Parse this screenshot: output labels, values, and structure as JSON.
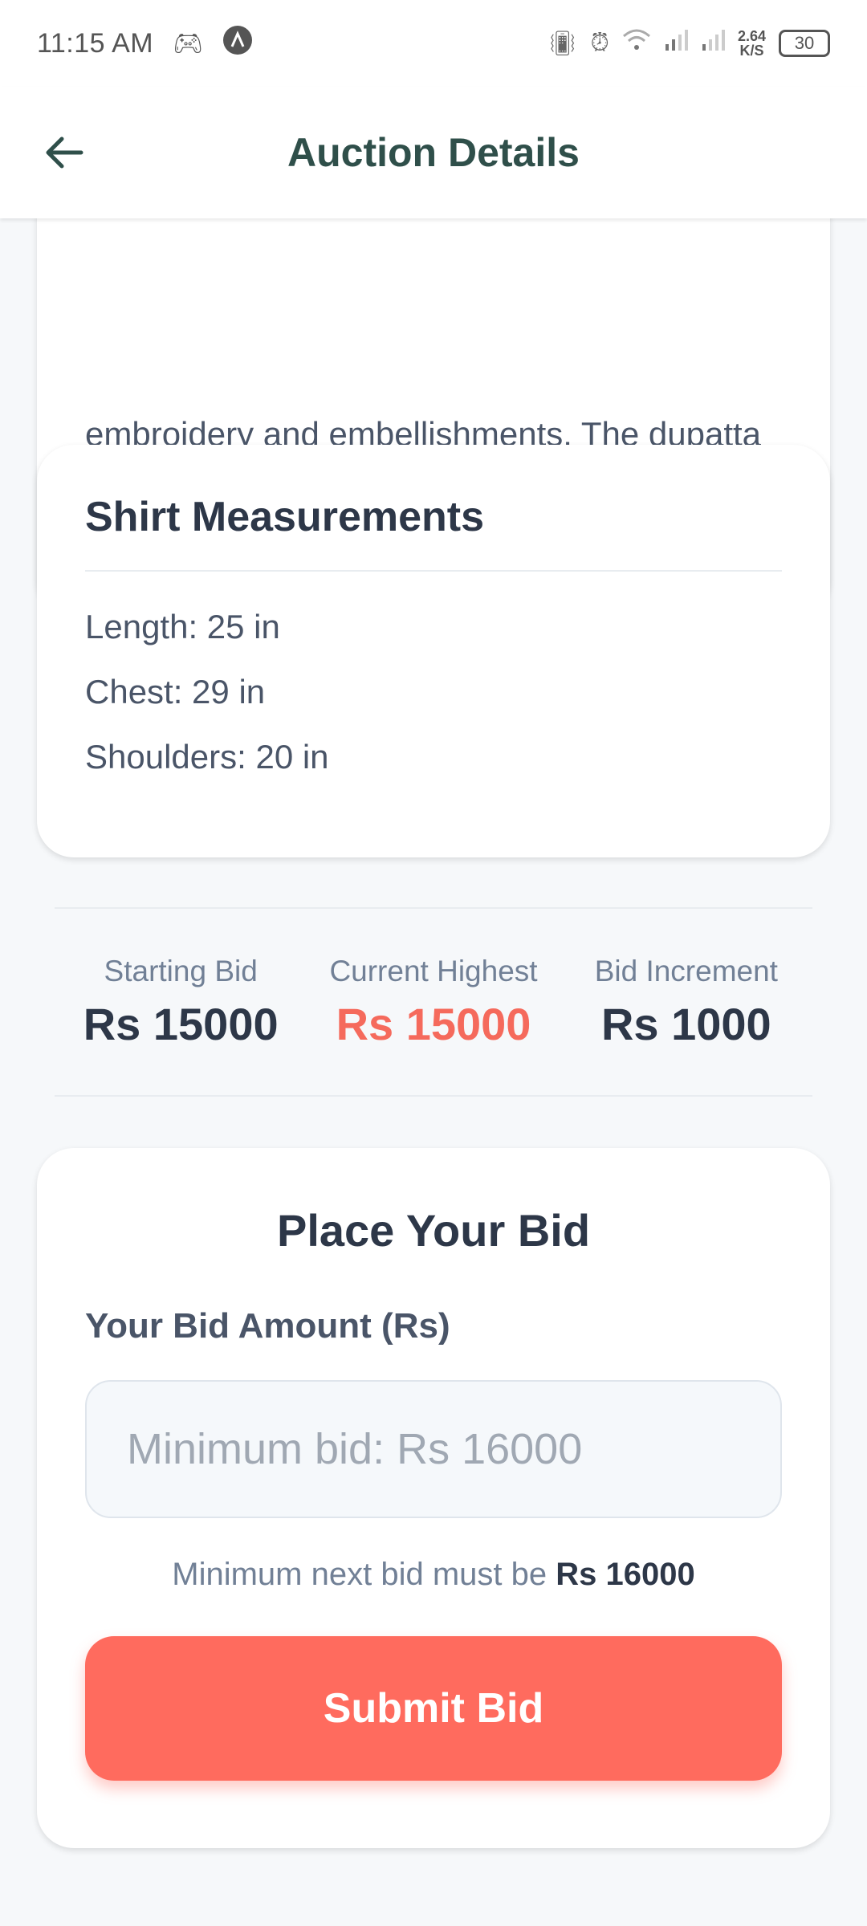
{
  "status_bar": {
    "time": "11:15 AM",
    "net_speed_value": "2.64",
    "net_speed_unit": "K/S",
    "battery": "30"
  },
  "app_bar": {
    "title": "Auction Details"
  },
  "description": {
    "text": "embroidery and embellishments. The dupatta is made of a light blue-green material with sequins and embroidery."
  },
  "measurements": {
    "title": "Shirt Measurements",
    "items": [
      "Length: 25 in",
      "Chest: 29 in",
      "Shoulders: 20 in"
    ]
  },
  "bid_stats": {
    "starting_label": "Starting Bid",
    "starting_value": "Rs 15000",
    "current_label": "Current Highest",
    "current_value": "Rs 15000",
    "increment_label": "Bid Increment",
    "increment_value": "Rs 1000"
  },
  "bid_form": {
    "title": "Place Your Bid",
    "amount_label": "Your Bid Amount (Rs)",
    "amount_placeholder": "Minimum bid: Rs 16000",
    "min_note_prefix": "Minimum next bid must be",
    "min_note_value": "Rs 16000",
    "submit_label": "Submit Bid"
  },
  "colors": {
    "accent": "#ff6b5e",
    "title_green": "#2f4f4a",
    "highlight": "#f56a5c"
  }
}
